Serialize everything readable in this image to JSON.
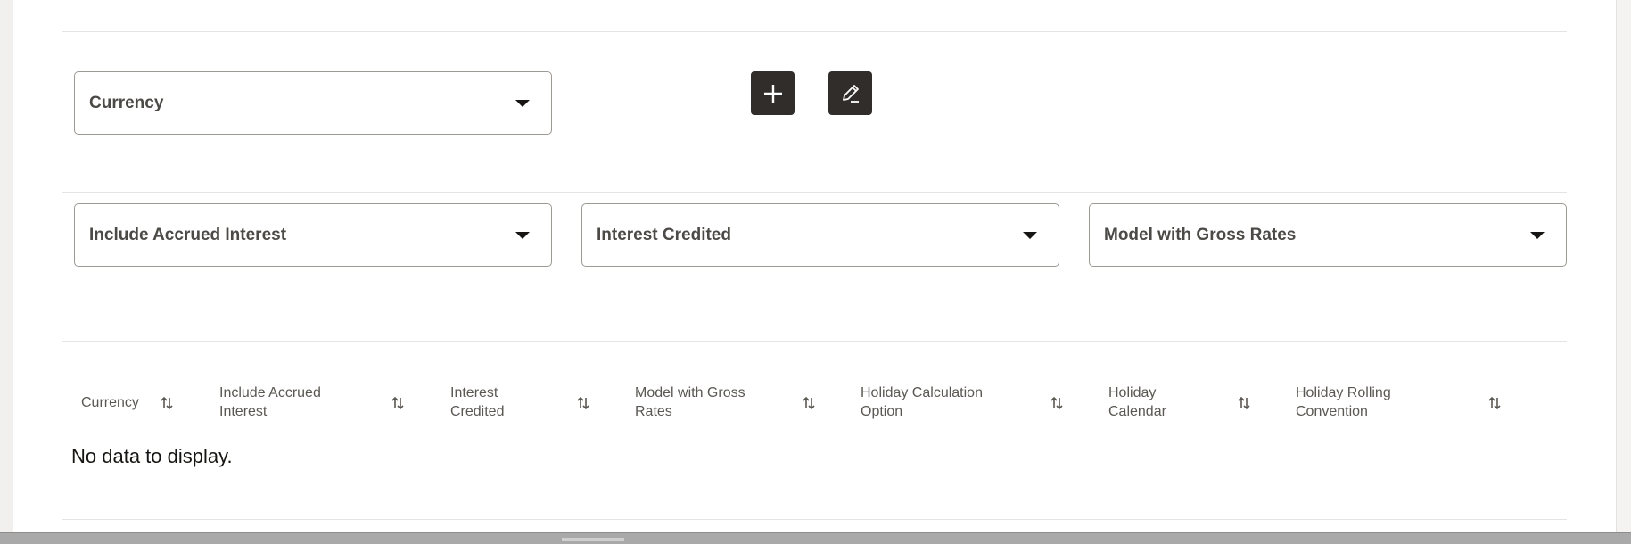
{
  "filters_row1": {
    "currency_select": {
      "label": "Currency"
    }
  },
  "toolbar": {
    "add_icon": "plus-icon",
    "edit_icon": "pencil-icon"
  },
  "filters_row2": {
    "include_accrued_interest": {
      "label": "Include Accrued Interest"
    },
    "interest_credited": {
      "label": "Interest Credited"
    },
    "model_with_gross_rates": {
      "label": "Model with Gross Rates"
    }
  },
  "table": {
    "columns": [
      {
        "label": "Currency"
      },
      {
        "label": "Include Accrued Interest"
      },
      {
        "label": "Interest Credited"
      },
      {
        "label": "Model with Gross Rates"
      },
      {
        "label": "Holiday Calculation Option"
      },
      {
        "label": "Holiday Calendar"
      },
      {
        "label": "Holiday Rolling Convention"
      }
    ],
    "empty_message": "No data to display.",
    "sort_icon": "sort-arrows-icon"
  },
  "colors": {
    "button_bg": "#312d2a",
    "border": "#9d9994",
    "label": "#4c4a46"
  }
}
